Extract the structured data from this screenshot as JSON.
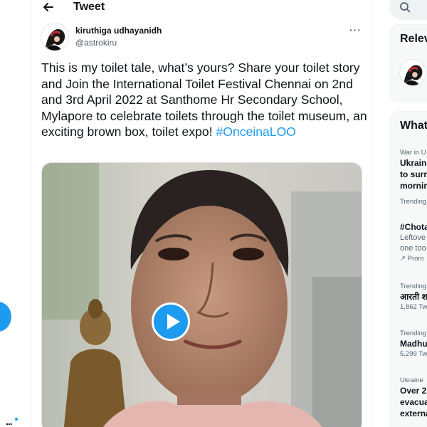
{
  "header": {
    "title": "Tweet"
  },
  "author": {
    "display_name": "kiruthiga udhayanidh",
    "handle": "@astrokiru"
  },
  "tweet": {
    "text": "This is my toilet tale, what’s yours? Share your toilet story and Join the International Toilet Festival Chennai on 2nd and 3rd April 2022 at Santhome Hr Secondary School, Mylapore to celebrate toilets through the toilet museum, an exciting brown box, toilet expo!",
    "hashtag": "#OnceinaLOO"
  },
  "sidebar": {
    "relevant_title": "Relev",
    "trends_title": "What",
    "trends": [
      {
        "meta": "War in U",
        "lines": [
          "Ukraine",
          "to surre",
          "mornin"
        ]
      },
      {
        "meta": "Trending",
        "lines": []
      },
      {
        "meta": "",
        "lines": [
          "#Chota"
        ],
        "sub": [
          "Leftove",
          "one too"
        ],
        "promo": "Prom"
      },
      {
        "meta": "Trending",
        "lines": [
          "आरती श"
        ],
        "count": "1,862 Tw"
      },
      {
        "meta": "Trending",
        "lines": [
          "Madhu"
        ],
        "count": "5,299 Tw"
      },
      {
        "meta": "Ukraine",
        "lines": [
          "Over 2",
          "evacua",
          "externa"
        ]
      }
    ]
  },
  "left_nav": {
    "more_label": "..."
  },
  "colors": {
    "accent": "#1d9bf0",
    "text": "#0f1419",
    "muted": "#536471",
    "card_bg": "#f7f9f9"
  }
}
